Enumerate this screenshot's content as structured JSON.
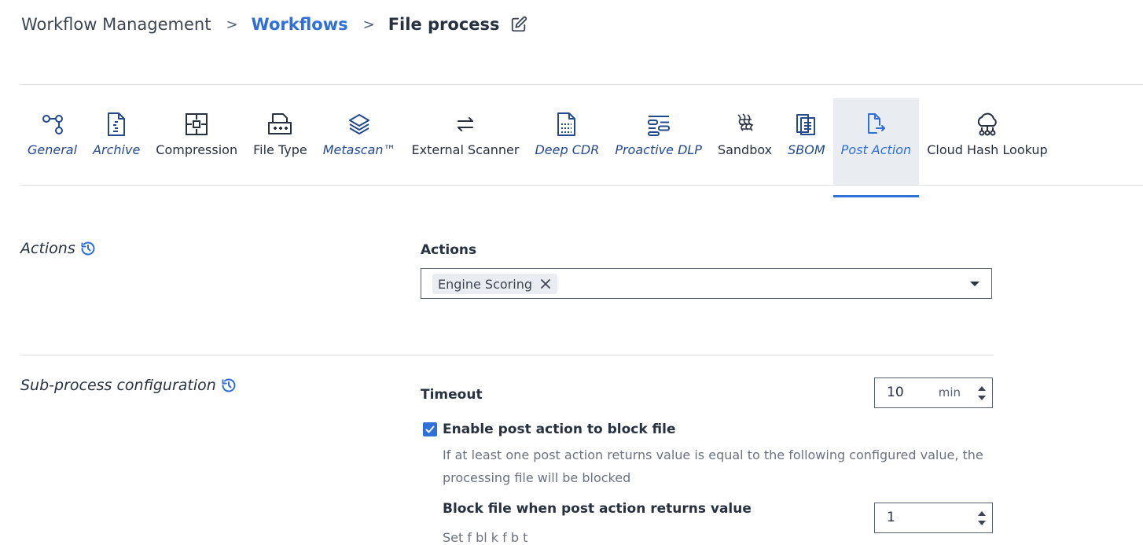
{
  "breadcrumb": {
    "root": "Workflow Management",
    "link": "Workflows",
    "current": "File process",
    "separator": ">"
  },
  "tabs": [
    {
      "label": "General",
      "icon": "branch-icon",
      "style": "link"
    },
    {
      "label": "Archive",
      "icon": "archive-file-icon",
      "style": "link"
    },
    {
      "label": "Compression",
      "icon": "compress-icon",
      "style": "plain"
    },
    {
      "label": "File Type",
      "icon": "file-type-icon",
      "style": "plain"
    },
    {
      "label": "Metascan™",
      "icon": "layers-icon",
      "style": "link"
    },
    {
      "label": "External Scanner",
      "icon": "swap-arrows-icon",
      "style": "plain"
    },
    {
      "label": "Deep CDR",
      "icon": "deep-cdr-icon",
      "style": "link"
    },
    {
      "label": "Proactive DLP",
      "icon": "dlp-icon",
      "style": "link"
    },
    {
      "label": "Sandbox",
      "icon": "sandbox-icon",
      "style": "plain"
    },
    {
      "label": "SBOM",
      "icon": "sbom-icon",
      "style": "link"
    },
    {
      "label": "Post Action",
      "icon": "post-action-icon",
      "style": "active"
    },
    {
      "label": "Cloud Hash Lookup",
      "icon": "cloud-network-icon",
      "style": "plain"
    }
  ],
  "actions_section": {
    "title": "Actions",
    "field_label": "Actions",
    "selected_chip": "Engine Scoring"
  },
  "subprocess_section": {
    "title": "Sub-process configuration",
    "timeout_label": "Timeout",
    "timeout_value": "10",
    "timeout_unit": "min",
    "checkbox_label": "Enable post action to block file",
    "checkbox_description": "If at least one post action returns value is equal to the following configured value, the processing file will be blocked",
    "block_value_label": "Block file when post action returns value",
    "block_value": "1",
    "cutoff_text": "Set             f                 bl   k                 f  b     t"
  },
  "colors": {
    "accent": "#2f6fd8",
    "link_dark": "#234a8e",
    "text": "#283140",
    "muted": "#6b7280",
    "divider": "#dde1e6",
    "active_tab_bg": "#e9ecf1"
  }
}
